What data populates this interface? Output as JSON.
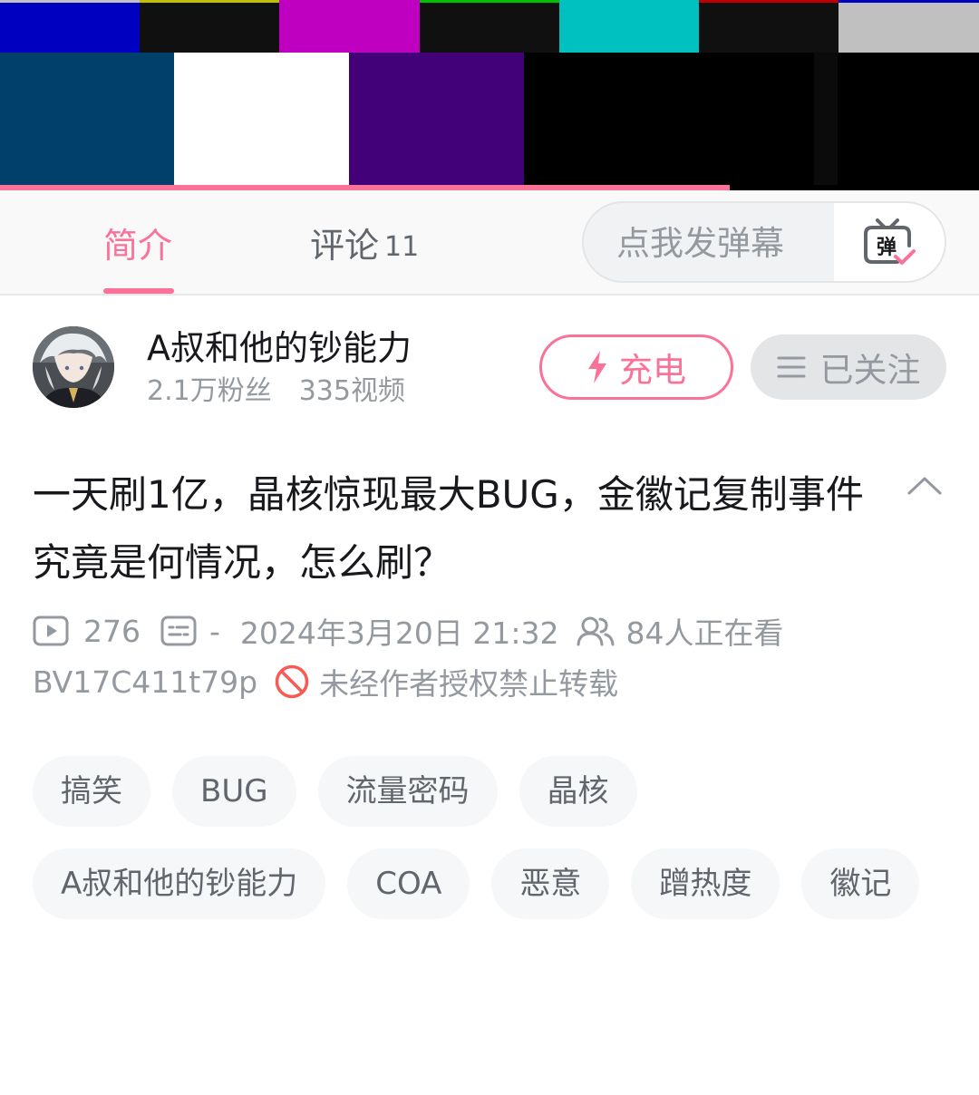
{
  "player": {
    "progress_fraction": 0.745,
    "test_pattern_top": [
      "#0000c0",
      "#101010",
      "#c000c0",
      "#101010",
      "#00c0c0",
      "#101010",
      "#c0c0c0"
    ],
    "test_pattern_caps": [
      "#c0c0c0",
      "#c0c000",
      "#c000c0",
      "#00c000",
      "#00c0c0",
      "#c00000",
      "#0000c0"
    ],
    "test_pattern_bottom": [
      "#00406a",
      "#ffffff",
      "#420079",
      "#000000",
      "#000000",
      "#0b0b0b",
      "#000000"
    ]
  },
  "tabs": {
    "intro": "简介",
    "comments": "评论",
    "comments_count": "11",
    "danmaku_placeholder": "点我发弹幕",
    "danmaku_button": "弹"
  },
  "uploader": {
    "name": "A叔和他的钞能力",
    "fans": "2.1万粉丝",
    "videos": "335视频",
    "charge_label": "充电",
    "follow_label": "已关注"
  },
  "video": {
    "title": "一天刷1亿，晶核惊现最大BUG，金徽记复制事件究竟是何情况，怎么刷？",
    "play_count": "276",
    "danmaku_count": "-",
    "publish_time": "2024年3月20日 21:32",
    "watching": "84人正在看",
    "bvid": "BV17C411t79p",
    "copyright_notice": "未经作者授权禁止转载"
  },
  "tags": [
    "搞笑",
    "BUG",
    "流量密码",
    "晶核",
    "A叔和他的钞能力",
    "COA",
    "恶意",
    "蹭热度",
    "徽记"
  ],
  "colors": {
    "accent": "#fb7299",
    "muted_text": "#9499a0",
    "tag_bg": "#f6f7f8",
    "prohibit_red": "#f85a54"
  }
}
